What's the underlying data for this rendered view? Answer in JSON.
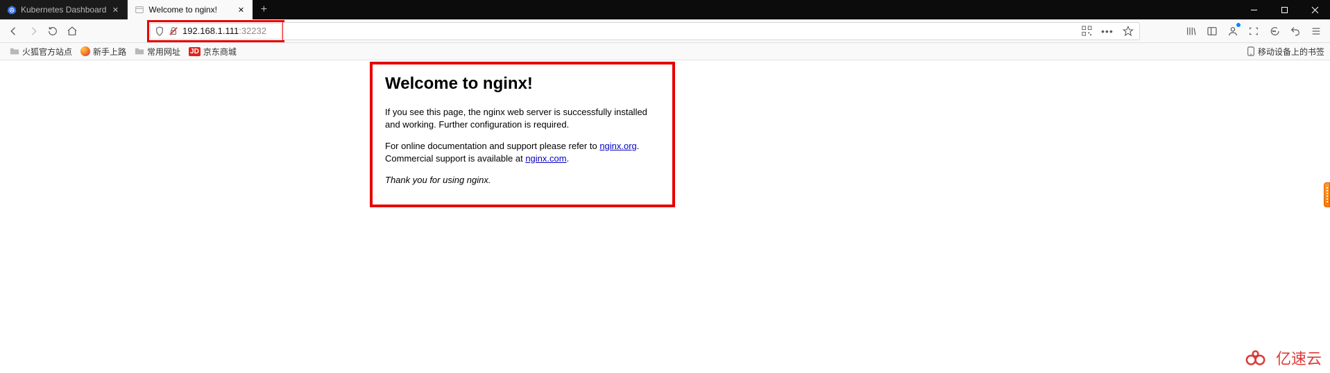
{
  "tabs": [
    {
      "label": "Kubernetes Dashboard",
      "active": false
    },
    {
      "label": "Welcome to nginx!",
      "active": true
    }
  ],
  "url": {
    "ip": "192.168.1.111",
    "port": ":32232"
  },
  "bookmarks": {
    "b0": "火狐官方站点",
    "b1": "新手上路",
    "b2": "常用网址",
    "b3": "京东商城",
    "mobile": "移动设备上的书签"
  },
  "page": {
    "title": "Welcome to nginx!",
    "p1a": "If you see this page, the nginx web server is successfully installed and working. Further configuration is required.",
    "p2a": "For online documentation and support please refer to ",
    "link1": "nginx.org",
    "p2b": ".",
    "p2c": "Commercial support is available at ",
    "link2": "nginx.com",
    "p2d": ".",
    "thanks": "Thank you for using nginx."
  },
  "watermark": "亿速云"
}
